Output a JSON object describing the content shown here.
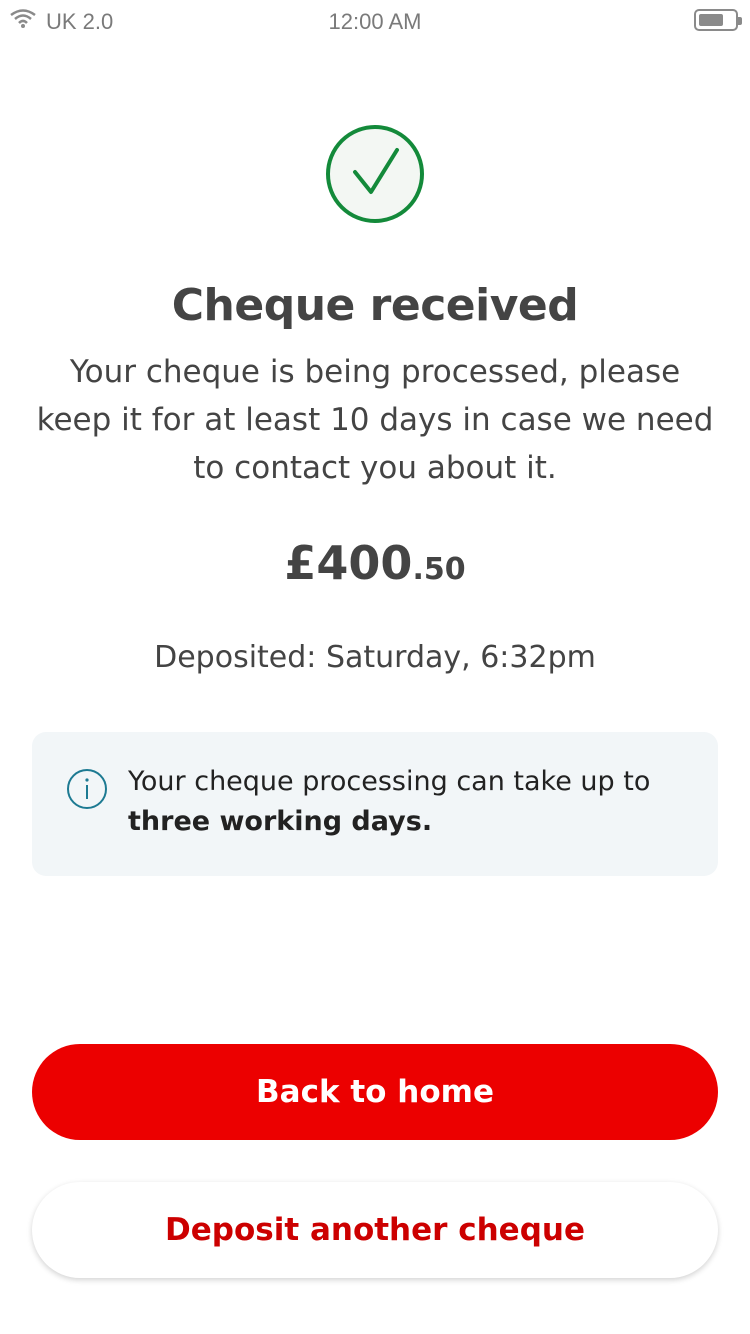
{
  "status_bar": {
    "carrier": "UK 2.0",
    "time": "12:00 AM",
    "icons": [
      "wifi-icon",
      "battery-icon"
    ]
  },
  "success": {
    "icon": "checkmark-circle-icon",
    "title": "Cheque received",
    "message": "Your cheque is being processed, please keep it for at least 10 days in case we need to contact you about it."
  },
  "amount": {
    "major": "£400",
    "minor": ".50"
  },
  "deposited": "Deposited: Saturday, 6:32pm",
  "info": {
    "icon": "info-icon",
    "text": "Your cheque processing can take up to",
    "emphasis": "three working days."
  },
  "actions": {
    "primary_label": "Back to home",
    "secondary_label": "Deposit another cheque"
  },
  "colors": {
    "brand_red": "#ec0000",
    "success_green": "#138a3a",
    "info_blue": "#1d7a92"
  }
}
